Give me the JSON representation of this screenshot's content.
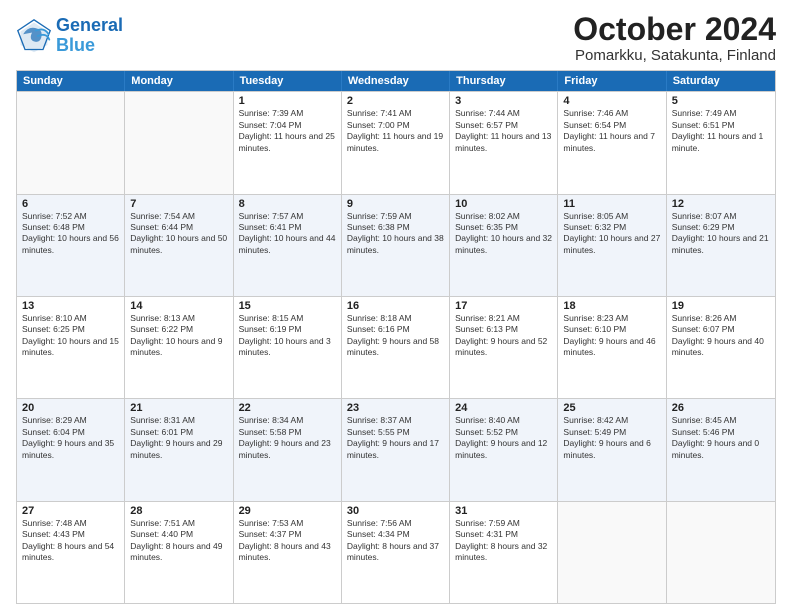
{
  "logo": {
    "line1": "General",
    "line2": "Blue"
  },
  "title": "October 2024",
  "subtitle": "Pomarkku, Satakunta, Finland",
  "days": [
    "Sunday",
    "Monday",
    "Tuesday",
    "Wednesday",
    "Thursday",
    "Friday",
    "Saturday"
  ],
  "rows": [
    [
      {
        "day": "",
        "sunrise": "",
        "sunset": "",
        "daylight": ""
      },
      {
        "day": "",
        "sunrise": "",
        "sunset": "",
        "daylight": ""
      },
      {
        "day": "1",
        "sunrise": "Sunrise: 7:39 AM",
        "sunset": "Sunset: 7:04 PM",
        "daylight": "Daylight: 11 hours and 25 minutes."
      },
      {
        "day": "2",
        "sunrise": "Sunrise: 7:41 AM",
        "sunset": "Sunset: 7:00 PM",
        "daylight": "Daylight: 11 hours and 19 minutes."
      },
      {
        "day": "3",
        "sunrise": "Sunrise: 7:44 AM",
        "sunset": "Sunset: 6:57 PM",
        "daylight": "Daylight: 11 hours and 13 minutes."
      },
      {
        "day": "4",
        "sunrise": "Sunrise: 7:46 AM",
        "sunset": "Sunset: 6:54 PM",
        "daylight": "Daylight: 11 hours and 7 minutes."
      },
      {
        "day": "5",
        "sunrise": "Sunrise: 7:49 AM",
        "sunset": "Sunset: 6:51 PM",
        "daylight": "Daylight: 11 hours and 1 minute."
      }
    ],
    [
      {
        "day": "6",
        "sunrise": "Sunrise: 7:52 AM",
        "sunset": "Sunset: 6:48 PM",
        "daylight": "Daylight: 10 hours and 56 minutes."
      },
      {
        "day": "7",
        "sunrise": "Sunrise: 7:54 AM",
        "sunset": "Sunset: 6:44 PM",
        "daylight": "Daylight: 10 hours and 50 minutes."
      },
      {
        "day": "8",
        "sunrise": "Sunrise: 7:57 AM",
        "sunset": "Sunset: 6:41 PM",
        "daylight": "Daylight: 10 hours and 44 minutes."
      },
      {
        "day": "9",
        "sunrise": "Sunrise: 7:59 AM",
        "sunset": "Sunset: 6:38 PM",
        "daylight": "Daylight: 10 hours and 38 minutes."
      },
      {
        "day": "10",
        "sunrise": "Sunrise: 8:02 AM",
        "sunset": "Sunset: 6:35 PM",
        "daylight": "Daylight: 10 hours and 32 minutes."
      },
      {
        "day": "11",
        "sunrise": "Sunrise: 8:05 AM",
        "sunset": "Sunset: 6:32 PM",
        "daylight": "Daylight: 10 hours and 27 minutes."
      },
      {
        "day": "12",
        "sunrise": "Sunrise: 8:07 AM",
        "sunset": "Sunset: 6:29 PM",
        "daylight": "Daylight: 10 hours and 21 minutes."
      }
    ],
    [
      {
        "day": "13",
        "sunrise": "Sunrise: 8:10 AM",
        "sunset": "Sunset: 6:25 PM",
        "daylight": "Daylight: 10 hours and 15 minutes."
      },
      {
        "day": "14",
        "sunrise": "Sunrise: 8:13 AM",
        "sunset": "Sunset: 6:22 PM",
        "daylight": "Daylight: 10 hours and 9 minutes."
      },
      {
        "day": "15",
        "sunrise": "Sunrise: 8:15 AM",
        "sunset": "Sunset: 6:19 PM",
        "daylight": "Daylight: 10 hours and 3 minutes."
      },
      {
        "day": "16",
        "sunrise": "Sunrise: 8:18 AM",
        "sunset": "Sunset: 6:16 PM",
        "daylight": "Daylight: 9 hours and 58 minutes."
      },
      {
        "day": "17",
        "sunrise": "Sunrise: 8:21 AM",
        "sunset": "Sunset: 6:13 PM",
        "daylight": "Daylight: 9 hours and 52 minutes."
      },
      {
        "day": "18",
        "sunrise": "Sunrise: 8:23 AM",
        "sunset": "Sunset: 6:10 PM",
        "daylight": "Daylight: 9 hours and 46 minutes."
      },
      {
        "day": "19",
        "sunrise": "Sunrise: 8:26 AM",
        "sunset": "Sunset: 6:07 PM",
        "daylight": "Daylight: 9 hours and 40 minutes."
      }
    ],
    [
      {
        "day": "20",
        "sunrise": "Sunrise: 8:29 AM",
        "sunset": "Sunset: 6:04 PM",
        "daylight": "Daylight: 9 hours and 35 minutes."
      },
      {
        "day": "21",
        "sunrise": "Sunrise: 8:31 AM",
        "sunset": "Sunset: 6:01 PM",
        "daylight": "Daylight: 9 hours and 29 minutes."
      },
      {
        "day": "22",
        "sunrise": "Sunrise: 8:34 AM",
        "sunset": "Sunset: 5:58 PM",
        "daylight": "Daylight: 9 hours and 23 minutes."
      },
      {
        "day": "23",
        "sunrise": "Sunrise: 8:37 AM",
        "sunset": "Sunset: 5:55 PM",
        "daylight": "Daylight: 9 hours and 17 minutes."
      },
      {
        "day": "24",
        "sunrise": "Sunrise: 8:40 AM",
        "sunset": "Sunset: 5:52 PM",
        "daylight": "Daylight: 9 hours and 12 minutes."
      },
      {
        "day": "25",
        "sunrise": "Sunrise: 8:42 AM",
        "sunset": "Sunset: 5:49 PM",
        "daylight": "Daylight: 9 hours and 6 minutes."
      },
      {
        "day": "26",
        "sunrise": "Sunrise: 8:45 AM",
        "sunset": "Sunset: 5:46 PM",
        "daylight": "Daylight: 9 hours and 0 minutes."
      }
    ],
    [
      {
        "day": "27",
        "sunrise": "Sunrise: 7:48 AM",
        "sunset": "Sunset: 4:43 PM",
        "daylight": "Daylight: 8 hours and 54 minutes."
      },
      {
        "day": "28",
        "sunrise": "Sunrise: 7:51 AM",
        "sunset": "Sunset: 4:40 PM",
        "daylight": "Daylight: 8 hours and 49 minutes."
      },
      {
        "day": "29",
        "sunrise": "Sunrise: 7:53 AM",
        "sunset": "Sunset: 4:37 PM",
        "daylight": "Daylight: 8 hours and 43 minutes."
      },
      {
        "day": "30",
        "sunrise": "Sunrise: 7:56 AM",
        "sunset": "Sunset: 4:34 PM",
        "daylight": "Daylight: 8 hours and 37 minutes."
      },
      {
        "day": "31",
        "sunrise": "Sunrise: 7:59 AM",
        "sunset": "Sunset: 4:31 PM",
        "daylight": "Daylight: 8 hours and 32 minutes."
      },
      {
        "day": "",
        "sunrise": "",
        "sunset": "",
        "daylight": ""
      },
      {
        "day": "",
        "sunrise": "",
        "sunset": "",
        "daylight": ""
      }
    ]
  ]
}
